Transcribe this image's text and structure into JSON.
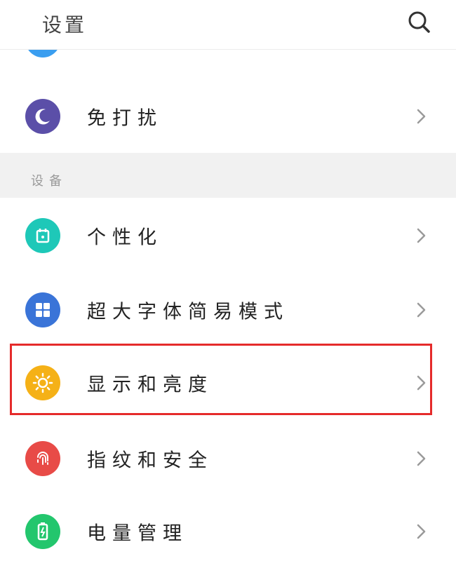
{
  "header": {
    "title": "设置",
    "search_icon": "search-icon"
  },
  "colors": {
    "partial": "#3a9ef0",
    "dnd": "#5b4fa8",
    "personalize": "#1ec8b8",
    "bigfont": "#3a74d8",
    "display": "#f5b117",
    "fingerprint": "#e84b47",
    "battery": "#23c66d",
    "highlight": "#e52b2b"
  },
  "partial_item": {
    "icon": "app-icon"
  },
  "dnd_item": {
    "label": "免打扰",
    "icon": "moon-icon"
  },
  "section": {
    "label": "设备"
  },
  "items": [
    {
      "label": "个性化",
      "icon": "palette-icon"
    },
    {
      "label": "超大字体简易模式",
      "icon": "grid-icon"
    },
    {
      "label": "显示和亮度",
      "icon": "sun-icon"
    },
    {
      "label": "指纹和安全",
      "icon": "fingerprint-icon"
    },
    {
      "label": "电量管理",
      "icon": "battery-icon"
    }
  ]
}
